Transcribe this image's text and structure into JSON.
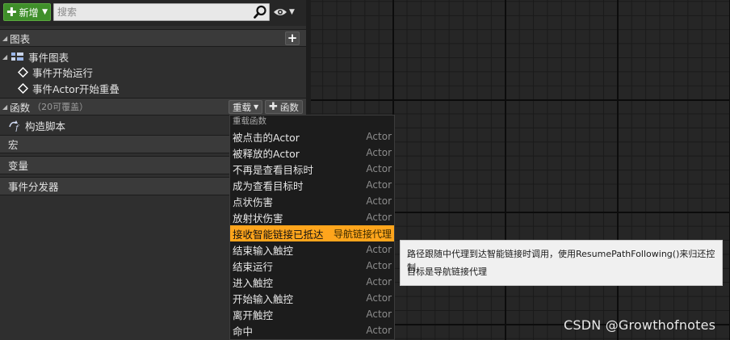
{
  "toolbar": {
    "new_label": "新增",
    "search_placeholder": "搜索"
  },
  "sections": {
    "graphs": {
      "label": "图表"
    },
    "event_graph": {
      "label": "事件图表"
    },
    "events": [
      "事件开始运行",
      "事件Actor开始重叠"
    ],
    "functions": {
      "label": "函数",
      "count_note": "（20可覆盖）",
      "override_label": "重载",
      "add_label": "函数"
    },
    "construction_script": "构造脚本",
    "macros": "宏",
    "variables": "变量",
    "dispatchers": "事件分发器"
  },
  "menu": {
    "header": "重载函数",
    "items": [
      {
        "label": "被点击的Actor",
        "category": "Actor",
        "selected": false
      },
      {
        "label": "被释放的Actor",
        "category": "Actor",
        "selected": false
      },
      {
        "label": "不再是查看目标时",
        "category": "Actor",
        "selected": false
      },
      {
        "label": "成为查看目标时",
        "category": "Actor",
        "selected": false
      },
      {
        "label": "点状伤害",
        "category": "Actor",
        "selected": false
      },
      {
        "label": "放射状伤害",
        "category": "Actor",
        "selected": false
      },
      {
        "label": "接收智能链接已抵达",
        "category": "导航链接代理",
        "selected": true
      },
      {
        "label": "结束输入触控",
        "category": "Actor",
        "selected": false
      },
      {
        "label": "结束运行",
        "category": "Actor",
        "selected": false
      },
      {
        "label": "进入触控",
        "category": "Actor",
        "selected": false
      },
      {
        "label": "开始输入触控",
        "category": "Actor",
        "selected": false
      },
      {
        "label": "离开触控",
        "category": "Actor",
        "selected": false
      },
      {
        "label": "命中",
        "category": "Actor",
        "selected": false
      }
    ]
  },
  "tooltip": {
    "line1": "路径跟随中代理到达智能链接时调用，使用ResumePathFollowing()来归还控制",
    "line2": "目标是导航链接代理"
  },
  "watermark": "CSDN @Growthofnotes",
  "colors": {
    "new_button": "#3f8f2a",
    "selected_item": "#ffa51c",
    "tooltip_bg": "#f0f0f0"
  }
}
